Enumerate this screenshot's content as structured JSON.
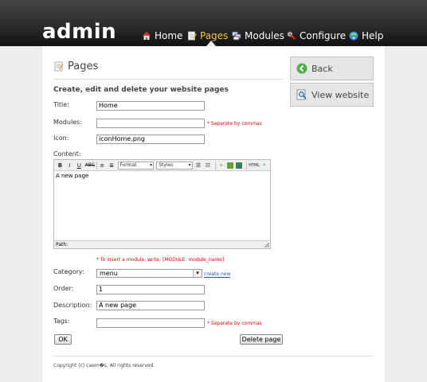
{
  "header": {
    "logo": "admin",
    "nav": [
      {
        "label": "Home",
        "icon": "home-icon",
        "active": false
      },
      {
        "label": "Pages",
        "icon": "pages-icon",
        "active": true
      },
      {
        "label": "Modules",
        "icon": "modules-icon",
        "active": false
      },
      {
        "label": "Configure",
        "icon": "configure-icon",
        "active": false
      },
      {
        "label": "Help",
        "icon": "help-icon",
        "active": false
      }
    ]
  },
  "page": {
    "title": "Pages",
    "subtitle": "Create, edit and delete your website pages"
  },
  "form": {
    "title_label": "Title:",
    "title_value": "Home",
    "modules_label": "Modules:",
    "modules_value": "",
    "modules_note": "* Separate by commas",
    "icon_label": "Icon:",
    "icon_value": "iconHome.png",
    "content_label": "Content:",
    "editor": {
      "format_label": "Format",
      "styles_label": "Styles",
      "html_label": "HTML",
      "body": "A new page",
      "path_label": "Path:"
    },
    "module_hint": "* To insert a module, write: [MODULE: module_name]",
    "category_label": "Category:",
    "category_value": "menu",
    "create_new": "create new",
    "order_label": "Order:",
    "order_value": "1",
    "description_label": "Description:",
    "description_value": "A new page",
    "tags_label": "Tags:",
    "tags_value": "",
    "tags_note": "* Separate by commas",
    "ok_label": "OK",
    "delete_label": "Delete page"
  },
  "sidebar": {
    "back_label": "Back",
    "view_label": "View website"
  },
  "footer": {
    "copyright": "Copyright (c) caem�s. All rights reserved."
  },
  "colors": {
    "active_nav": "#f5c842",
    "note_red": "#e00000",
    "link_blue": "#2255bb"
  }
}
